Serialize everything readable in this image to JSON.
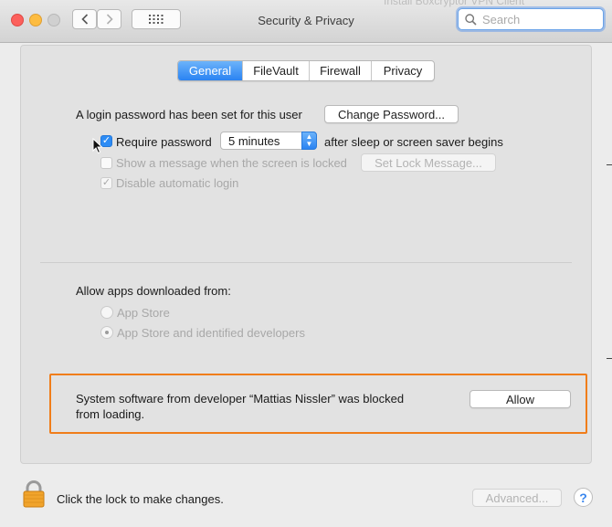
{
  "window": {
    "title": "Security & Privacy",
    "background_tab_text": "Install Boxcryptor VPN Client"
  },
  "toolbar": {
    "search_placeholder": "Search"
  },
  "tabs": [
    {
      "label": "General",
      "active": true
    },
    {
      "label": "FileVault",
      "active": false
    },
    {
      "label": "Firewall",
      "active": false
    },
    {
      "label": "Privacy",
      "active": false
    }
  ],
  "general": {
    "login_password_text": "A login password has been set for this user",
    "change_password_label": "Change Password...",
    "require_password_label": "Require password",
    "require_password_checked": true,
    "require_password_interval": "5 minutes",
    "after_sleep_text": "after sleep or screen saver begins",
    "show_message_label": "Show a message when the screen is locked",
    "show_message_checked": false,
    "set_lock_message_label": "Set Lock Message...",
    "disable_auto_login_label": "Disable automatic login",
    "disable_auto_login_checked": true
  },
  "apps": {
    "heading": "Allow apps downloaded from:",
    "options": [
      {
        "label": "App Store",
        "selected": false
      },
      {
        "label": "App Store and identified developers",
        "selected": true
      }
    ]
  },
  "blocked": {
    "line1": "System software from developer “Mattias Nissler” was blocked",
    "line2": "from loading.",
    "allow_label": "Allow",
    "highlight_color": "#f07d1a"
  },
  "footer": {
    "lock_text": "Click the lock to make changes.",
    "advanced_label": "Advanced...",
    "help_label": "?"
  },
  "colors": {
    "accent": "#2d8cf5",
    "window_bg": "#ececec",
    "panel_bg": "#e2e2e2"
  }
}
